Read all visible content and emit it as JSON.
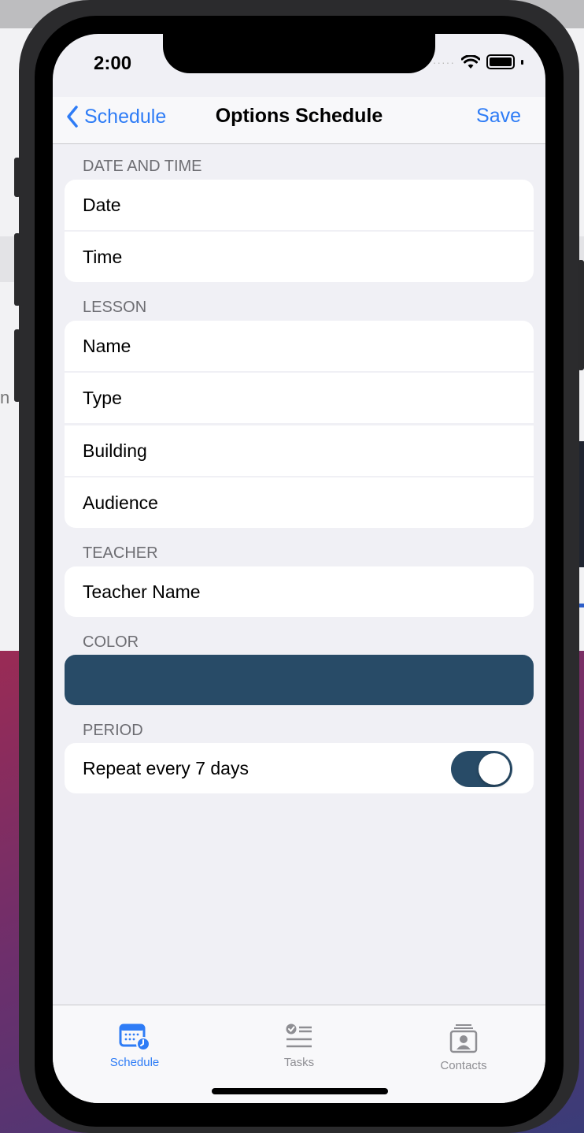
{
  "status_bar": {
    "time": "2:00",
    "signal": "·····"
  },
  "nav": {
    "back_label": "Schedule",
    "title": "Options Schedule",
    "save_label": "Save"
  },
  "sections": {
    "date_time": {
      "header": "DATE AND TIME",
      "rows": [
        "Date",
        "Time"
      ]
    },
    "lesson": {
      "header": "LESSON",
      "rows": [
        "Name",
        "Type",
        "Building",
        "Audience"
      ]
    },
    "teacher": {
      "header": "TEACHER",
      "rows": [
        "Teacher Name"
      ]
    },
    "color": {
      "header": "COLOR",
      "value": "#284b67"
    },
    "period": {
      "header": "PERIOD",
      "repeat_label": "Repeat every 7 days",
      "repeat_on": true
    }
  },
  "tabs": [
    {
      "label": "Schedule",
      "icon": "calendar-clock-icon",
      "active": true
    },
    {
      "label": "Tasks",
      "icon": "checklist-icon",
      "active": false
    },
    {
      "label": "Contacts",
      "icon": "contact-card-icon",
      "active": false
    }
  ],
  "colors": {
    "accent": "#2e7cf6",
    "inactive": "#8e8e93",
    "selected_color": "#284b67"
  }
}
